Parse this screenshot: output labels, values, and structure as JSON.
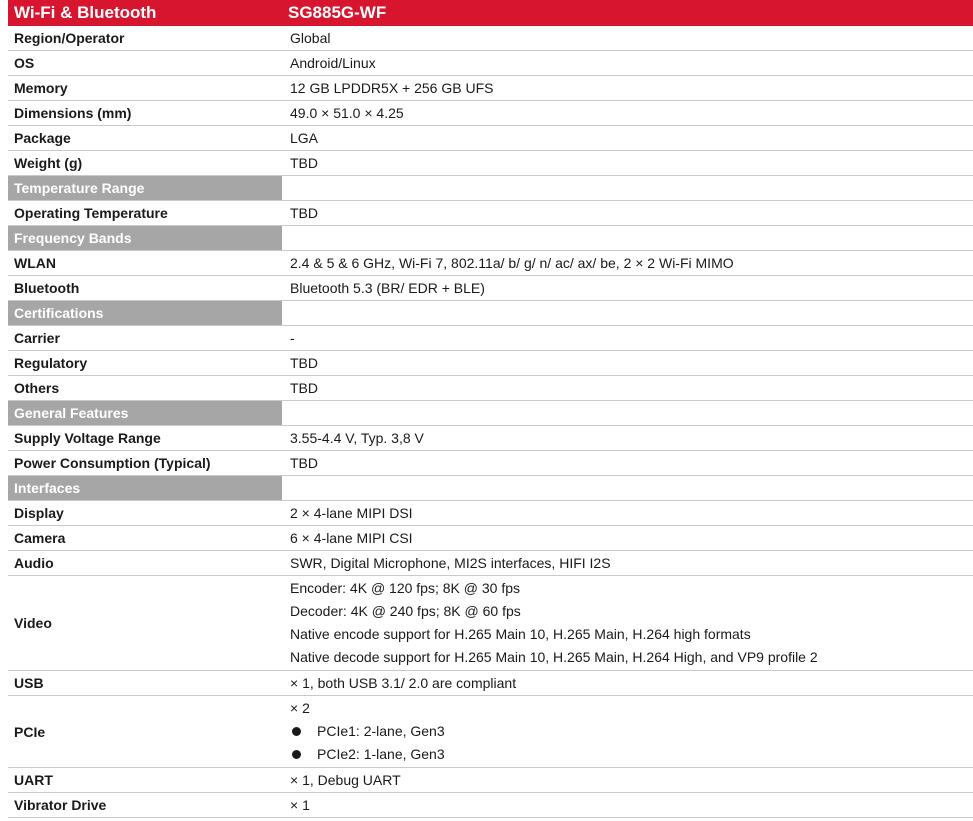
{
  "header": {
    "title": "Wi-Fi & Bluetooth",
    "model": "SG885G-WF"
  },
  "rows": [
    {
      "type": "row",
      "key": "Region/Operator",
      "value": "Global"
    },
    {
      "type": "row",
      "key": "OS",
      "value": "Android/Linux"
    },
    {
      "type": "row",
      "key": "Memory",
      "value": "12 GB LPDDR5X + 256 GB UFS"
    },
    {
      "type": "row",
      "key": "Dimensions (mm)",
      "value": "49.0 × 51.0 × 4.25"
    },
    {
      "type": "row",
      "key": "Package",
      "value": "LGA"
    },
    {
      "type": "row",
      "key": "Weight (g)",
      "value": "TBD"
    },
    {
      "type": "section",
      "title": "Temperature  Range"
    },
    {
      "type": "row",
      "key": "Operating Temperature",
      "value": "TBD"
    },
    {
      "type": "section",
      "title": "Frequency Bands"
    },
    {
      "type": "row",
      "key": "WLAN",
      "value": "2.4 & 5 & 6 GHz, Wi-Fi 7, 802.11a/ b/ g/ n/ ac/ ax/ be, 2 × 2 Wi-Fi MIMO"
    },
    {
      "type": "row",
      "key": "Bluetooth",
      "value": "Bluetooth 5.3 (BR/ EDR + BLE)"
    },
    {
      "type": "section",
      "title": "Certifications"
    },
    {
      "type": "row",
      "key": "Carrier",
      "value": "-"
    },
    {
      "type": "row",
      "key": "Regulatory",
      "value": "TBD"
    },
    {
      "type": "row",
      "key": "Others",
      "value": "TBD"
    },
    {
      "type": "section",
      "title": "General Features"
    },
    {
      "type": "row",
      "key": "Supply Voltage Range",
      "value": "3.55-4.4 V, Typ. 3,8 V"
    },
    {
      "type": "row",
      "key": "Power Consumption (Typical)",
      "value": "TBD"
    },
    {
      "type": "section",
      "title": "Interfaces"
    },
    {
      "type": "row",
      "key": "Display",
      "value": "2 × 4-lane MIPI DSI"
    },
    {
      "type": "row",
      "key": "Camera",
      "value": "6 × 4-lane MIPI CSI"
    },
    {
      "type": "row",
      "key": "Audio",
      "value": "SWR, Digital Microphone, MI2S interfaces, HIFI I2S"
    },
    {
      "type": "multi",
      "key": "Video",
      "lines": [
        "Encoder: 4K @ 120 fps; 8K @ 30 fps",
        "Decoder: 4K @ 240 fps; 8K @ 60 fps",
        "Native encode support for H.265 Main 10, H.265 Main, H.264 high formats",
        "Native decode support for H.265 Main 10, H.265 Main, H.264 High, and VP9 profile 2"
      ]
    },
    {
      "type": "row",
      "key": "USB",
      "value": "× 1, both USB 3.1/ 2.0  are compliant"
    },
    {
      "type": "bullets",
      "key": "PCIe",
      "intro": "× 2",
      "bullets": [
        "PCIe1: 2-lane, Gen3",
        "PCIe2: 1-lane, Gen3"
      ]
    },
    {
      "type": "row",
      "key": "UART",
      "value": "× 1, Debug UART"
    },
    {
      "type": "row",
      "key": "Vibrator Drive",
      "value": "× 1"
    }
  ]
}
